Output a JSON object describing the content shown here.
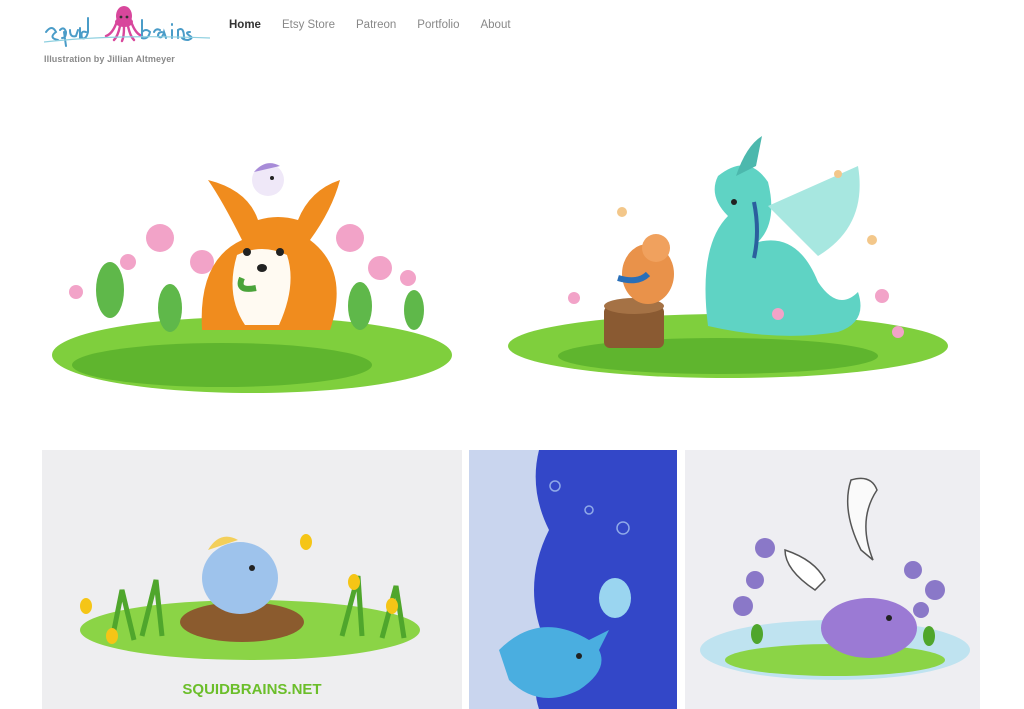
{
  "site": {
    "logo_text": "squidbrains",
    "tagline": "Illustration by Jillian Altmeyer"
  },
  "nav": {
    "items": [
      "Home",
      "Etsy Store",
      "Patreon",
      "Portfolio",
      "About"
    ],
    "active": "Home"
  },
  "gallery": {
    "watermark": "SQUIDBRAINS.NET",
    "colors": {
      "grass": "#6fc23a",
      "corgi_orange": "#f08c1e",
      "dragon_teal": "#59d1c4",
      "flower_pink": "#f2a3c8",
      "ocean_blue": "#3347c8",
      "violet": "#8a78c8"
    }
  }
}
